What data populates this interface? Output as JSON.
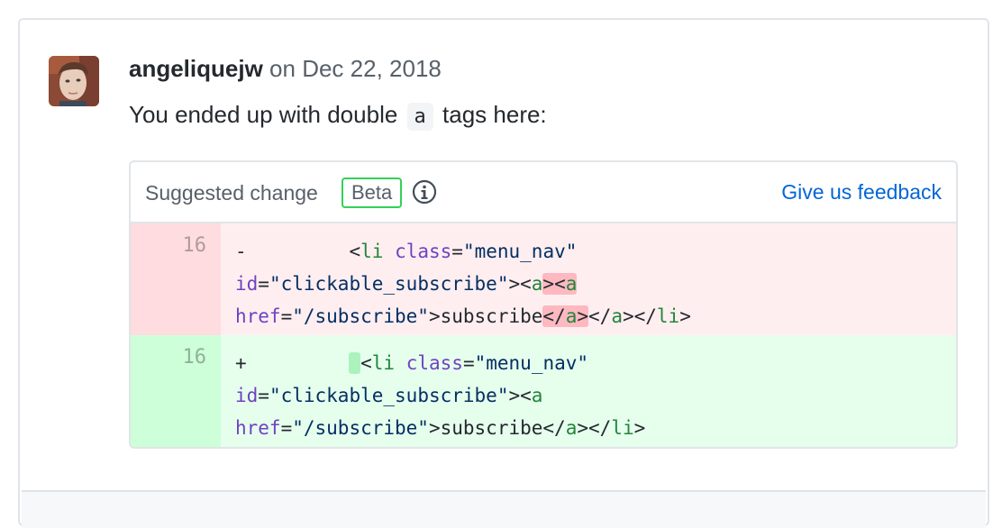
{
  "comment": {
    "author": "angeliquejw",
    "meta": "on Dec 22, 2018",
    "body_before": "You ended up with double",
    "body_code": "a",
    "body_after": "tags here:"
  },
  "suggestion": {
    "title": "Suggested change",
    "badge": "Beta",
    "info_icon": "info-icon",
    "feedback_link": "Give us feedback",
    "colors": {
      "deletion_bg": "#ffeef0",
      "addition_bg": "#e6ffed",
      "badge_border": "#34d058",
      "link": "#0366d6"
    },
    "removed": {
      "line_number": "16",
      "marker": "-",
      "indent": "        ",
      "line1": {
        "tag_open": "li",
        "attr_class": "class",
        "class_val": "\"menu_nav\""
      },
      "line2": {
        "attr_id": "id",
        "id_val": "\"clickable_subscribe\"",
        "tag_a1": "a",
        "tag_a2": "a"
      },
      "line3": {
        "attr_href": "href",
        "href_val": "\"/subscribe\"",
        "text": "subscribe",
        "close_a1": "a",
        "close_a2": "a",
        "close_li": "li"
      }
    },
    "added": {
      "line_number": "16",
      "marker": "+",
      "indent": "        ",
      "line1": {
        "tag_open": "li",
        "attr_class": "class",
        "class_val": "\"menu_nav\""
      },
      "line2": {
        "attr_id": "id",
        "id_val": "\"clickable_subscribe\"",
        "tag_a": "a"
      },
      "line3": {
        "attr_href": "href",
        "href_val": "\"/subscribe\"",
        "text": "subscribe",
        "close_a": "a",
        "close_li": "li"
      }
    }
  }
}
